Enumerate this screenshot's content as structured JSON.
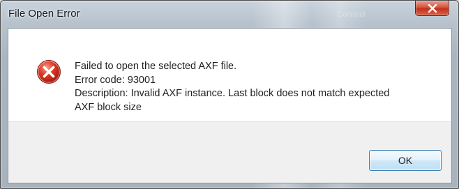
{
  "window": {
    "title": "File Open Error",
    "background_title_text": "Connect"
  },
  "dialog": {
    "icon": "error-icon",
    "message_lines": [
      "Failed to open the selected AXF file.",
      "Error code: 93001",
      "Description: Invalid AXF instance.  Last block does not match expected",
      "AXF block size"
    ]
  },
  "buttons": {
    "ok_label": "OK",
    "close_icon": "close-icon"
  },
  "colors": {
    "error_red": "#d42a1e",
    "ok_border": "#3c7fb1",
    "close_red": "#c0321b"
  }
}
